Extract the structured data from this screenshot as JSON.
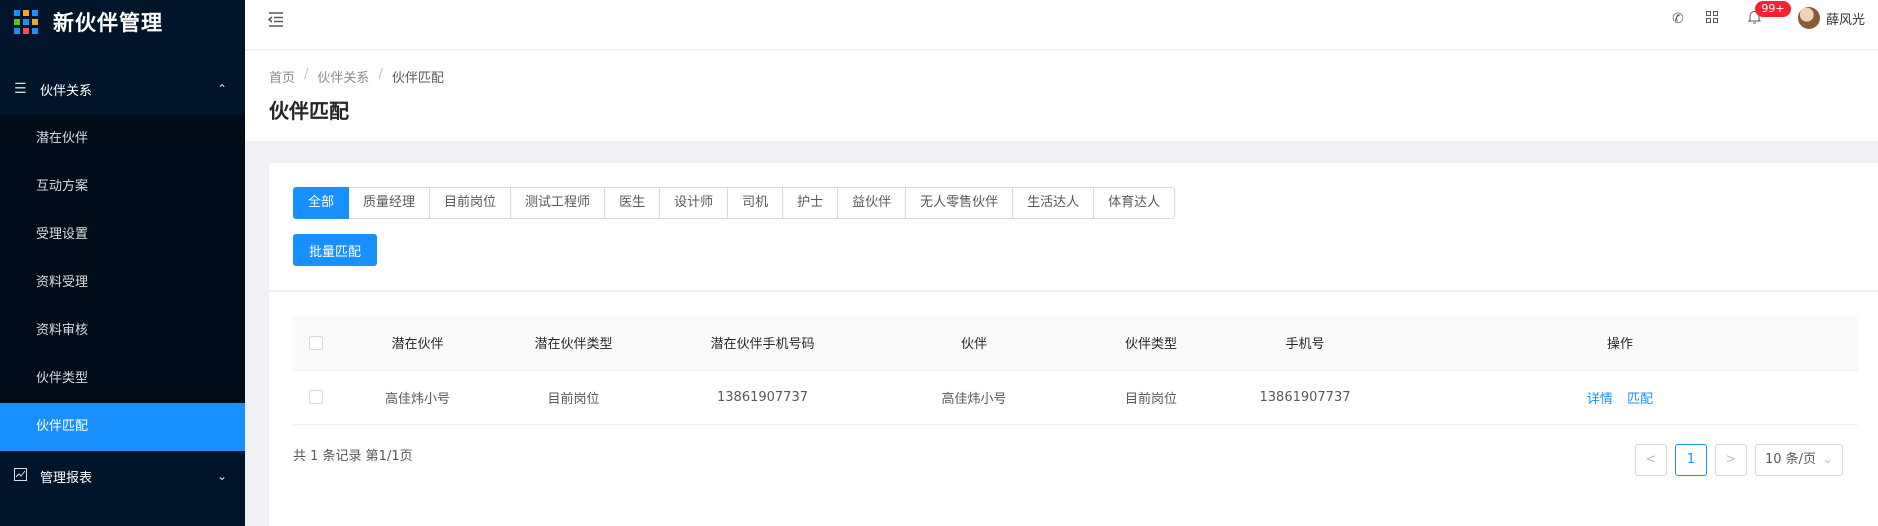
{
  "app": {
    "title": "新伙伴管理"
  },
  "sidebar": {
    "groups": [
      {
        "label": "伙伴关系",
        "expanded": true
      },
      {
        "label": "管理报表",
        "expanded": false
      }
    ],
    "items": [
      {
        "label": "潜在伙伴"
      },
      {
        "label": "互动方案"
      },
      {
        "label": "受理设置"
      },
      {
        "label": "资料受理"
      },
      {
        "label": "资料审核"
      },
      {
        "label": "伙伴类型"
      },
      {
        "label": "伙伴匹配",
        "active": true
      }
    ]
  },
  "header": {
    "icons": [
      "menu-fold-icon",
      "phone-icon",
      "apps-icon",
      "bell-icon"
    ],
    "notification_badge": "99+",
    "user_name": "薛风光"
  },
  "breadcrumb": [
    "首页",
    "伙伴关系",
    "伙伴匹配"
  ],
  "page_title": "伙伴匹配",
  "tabs": [
    {
      "label": "全部",
      "active": true
    },
    {
      "label": "质量经理"
    },
    {
      "label": "目前岗位"
    },
    {
      "label": "测试工程师"
    },
    {
      "label": "医生"
    },
    {
      "label": "设计师"
    },
    {
      "label": "司机"
    },
    {
      "label": "护士"
    },
    {
      "label": "益伙伴"
    },
    {
      "label": "无人零售伙伴"
    },
    {
      "label": "生活达人"
    },
    {
      "label": "体育达人"
    }
  ],
  "batch_button": "批量匹配",
  "table": {
    "columns": [
      "潜在伙伴",
      "潜在伙伴类型",
      "潜在伙伴手机号码",
      "伙伴",
      "伙伴类型",
      "手机号",
      "操作"
    ],
    "rows": [
      {
        "cells": [
          "高佳炜小号",
          "目前岗位",
          "13861907737",
          "高佳炜小号",
          "目前岗位",
          "13861907737"
        ],
        "actions": [
          "详情",
          "匹配"
        ]
      }
    ]
  },
  "pagination": {
    "summary": "共 1 条记录 第1/1页",
    "prev": "<",
    "current_page": "1",
    "next": ">",
    "page_size": "10 条/页"
  },
  "colors": {
    "primary": "#1890ff",
    "sidebar_bg": "#001529",
    "badge": "#f5222d"
  }
}
